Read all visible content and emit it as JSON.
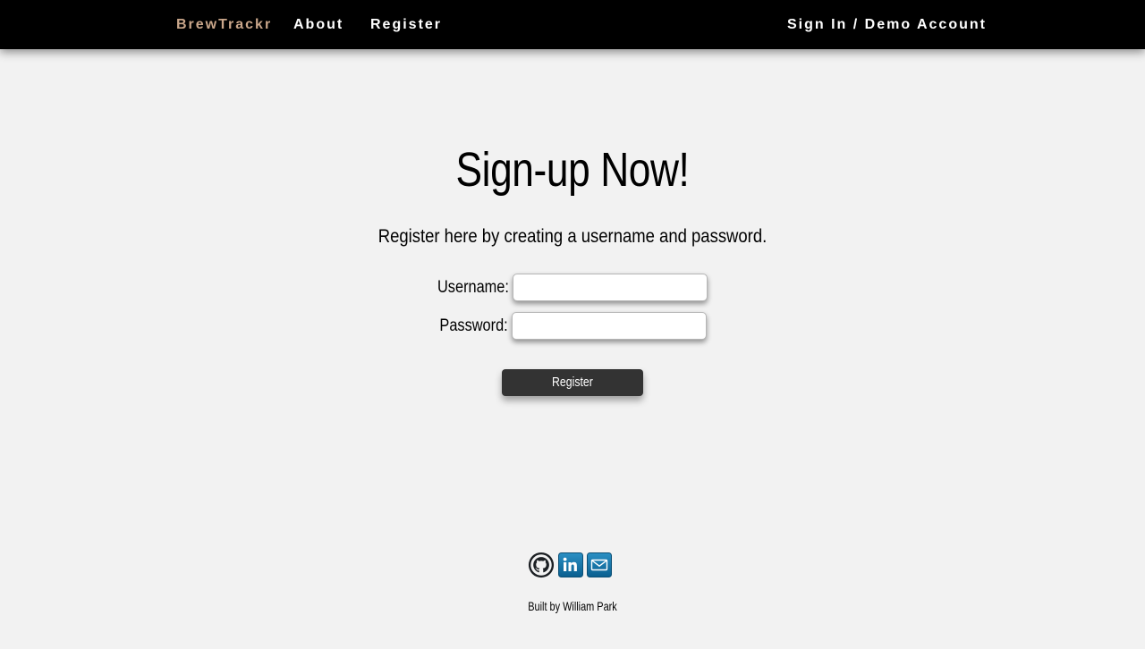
{
  "navbar": {
    "brand": "BrewTrackr",
    "links": [
      {
        "label": "About"
      },
      {
        "label": "Register"
      }
    ],
    "signin": "Sign In / Demo Account",
    "brand_color": "#c9a68a",
    "background_color": "#000000"
  },
  "main": {
    "title": "Sign-up Now!",
    "subtitle": "Register here by creating a username and password.",
    "form": {
      "username_label": "Username:",
      "username_value": "",
      "password_label": "Password:",
      "password_value": "",
      "submit_label": "Register",
      "submit_color": "#333333"
    }
  },
  "footer": {
    "icons": [
      "github-icon",
      "linkedin-icon",
      "email-icon"
    ],
    "credit": "Built by William Park"
  }
}
